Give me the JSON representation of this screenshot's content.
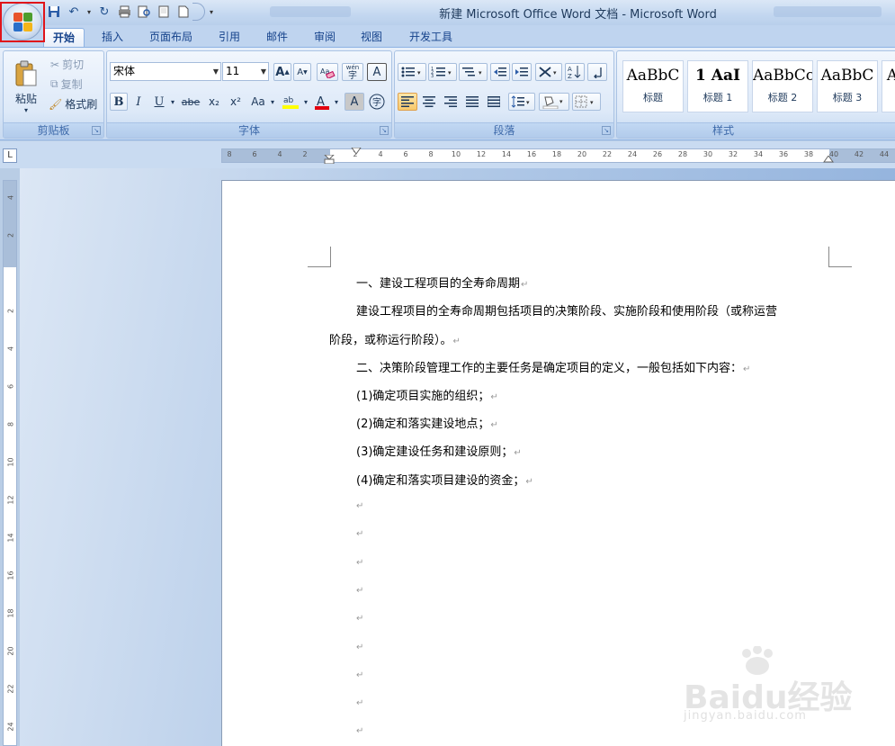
{
  "window": {
    "title": "新建 Microsoft Office Word 文档 - Microsoft Word"
  },
  "qat": {
    "undo_label": "↶",
    "redo_label": "↻"
  },
  "tabs": [
    "开始",
    "插入",
    "页面布局",
    "引用",
    "邮件",
    "审阅",
    "视图",
    "开发工具"
  ],
  "clipboard": {
    "paste": "粘贴",
    "cut": "剪切",
    "copy": "复制",
    "format_painter": "格式刷",
    "group": "剪贴板"
  },
  "font": {
    "name": "宋体",
    "size": "11",
    "group": "字体",
    "bold": "B",
    "italic": "I",
    "underline": "U",
    "strike": "abe",
    "sub": "x₂",
    "sup": "x²",
    "case": "Aa",
    "grow": "A",
    "shrink": "A",
    "phonetic": "wén",
    "border_char": "A",
    "shade_char": "A",
    "enclose": "字"
  },
  "paragraph": {
    "group": "段落"
  },
  "styles": {
    "group": "样式",
    "items": [
      {
        "sample": "AaBbC",
        "name": "标题"
      },
      {
        "sample": "1  AaI",
        "name": "标题 1"
      },
      {
        "sample": "AaBbCc",
        "name": "标题 2"
      },
      {
        "sample": "AaBbC",
        "name": "标题 3"
      },
      {
        "sample": "A",
        "name": ""
      }
    ]
  },
  "ruler": {
    "h_ticks": [
      "8",
      "6",
      "4",
      "2",
      "",
      "2",
      "4",
      "6",
      "8",
      "10",
      "12",
      "14",
      "16",
      "18",
      "20",
      "22",
      "24",
      "26",
      "28",
      "30",
      "32",
      "34",
      "36",
      "38",
      "40",
      "42",
      "44"
    ],
    "v_ticks": [
      "4",
      "2",
      "",
      "2",
      "4",
      "6",
      "8",
      "10",
      "12",
      "14",
      "16",
      "18",
      "20",
      "22",
      "24"
    ]
  },
  "document": {
    "lines": [
      "一、建设工程项目的全寿命周期",
      "建设工程项目的全寿命周期包括项目的决策阶段、实施阶段和使用阶段（或称运营",
      "阶段，或称运行阶段）。",
      "二、决策阶段管理工作的主要任务是确定项目的定义，一般包括如下内容：",
      "(1)确定项目实施的组织；",
      "(2)确定和落实建设地点；",
      "(3)确定建设任务和建设原则；",
      "(4)确定和落实项目建设的资金；"
    ],
    "para_mark": "↵"
  },
  "watermark": {
    "main": "Baidu经验",
    "sub": "jingyan.baidu.com"
  }
}
